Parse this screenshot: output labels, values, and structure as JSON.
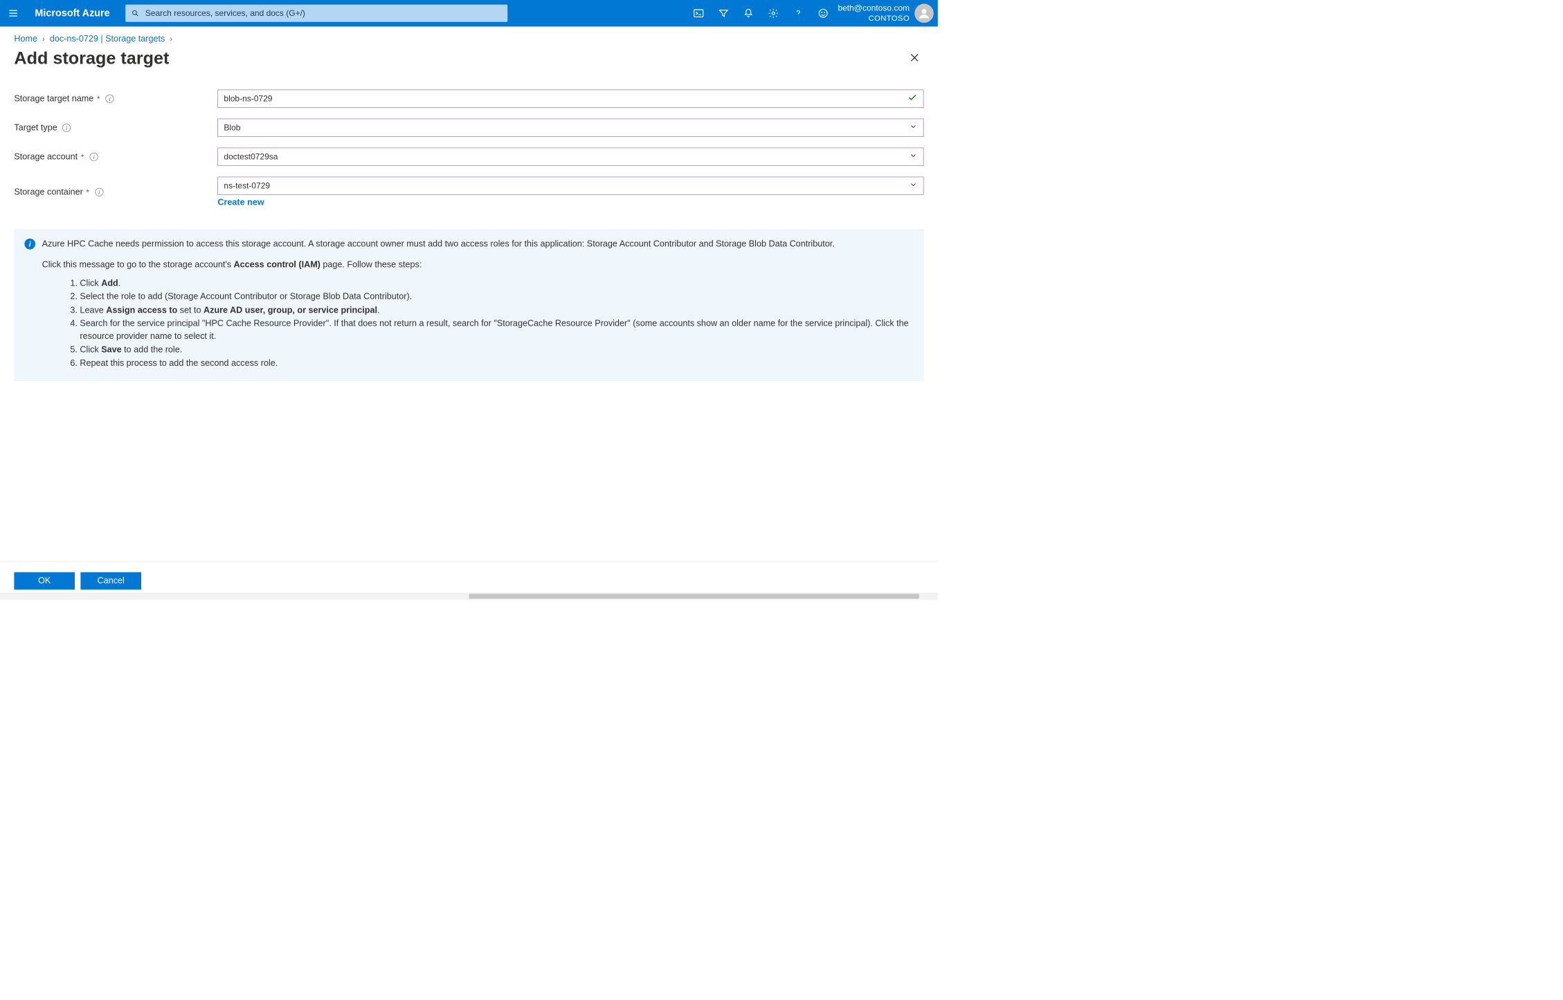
{
  "header": {
    "brand": "Microsoft Azure",
    "search_placeholder": "Search resources, services, and docs (G+/)",
    "user_email": "beth@contoso.com",
    "tenant": "CONTOSO"
  },
  "breadcrumb": {
    "home": "Home",
    "resource": "doc-ns-0729 | Storage targets"
  },
  "page": {
    "title": "Add storage target"
  },
  "form": {
    "storage_target_name": {
      "label": "Storage target name",
      "value": "blob-ns-0729"
    },
    "target_type": {
      "label": "Target type",
      "value": "Blob"
    },
    "storage_account": {
      "label": "Storage account",
      "value": "doctest0729sa"
    },
    "storage_container": {
      "label": "Storage container",
      "value": "ns-test-0729",
      "create_new": "Create new"
    }
  },
  "infobox": {
    "intro": "Azure HPC Cache needs permission to access this storage account. A storage account owner must add two access roles for this application: Storage Account Contributor and Storage Blob Data Contributor.",
    "click_msg_pre": "Click this message to go to the storage account's ",
    "click_msg_bold": "Access control (IAM)",
    "click_msg_post": " page. Follow these steps:",
    "steps": {
      "s1_pre": "Click ",
      "s1_b": "Add",
      "s1_post": ".",
      "s2": "Select the role to add (Storage Account Contributor or Storage Blob Data Contributor).",
      "s3_pre": "Leave ",
      "s3_b1": "Assign access to",
      "s3_mid": " set to ",
      "s3_b2": "Azure AD user, group, or service principal",
      "s3_post": ".",
      "s4": "Search for the service principal \"HPC Cache Resource Provider\". If that does not return a result, search for \"StorageCache Resource Provider\" (some accounts show an older name for the service principal). Click the resource provider name to select it.",
      "s5_pre": "Click ",
      "s5_b": "Save",
      "s5_post": " to add the role.",
      "s6": "Repeat this process to add the second access role."
    }
  },
  "footer": {
    "ok": "OK",
    "cancel": "Cancel"
  }
}
